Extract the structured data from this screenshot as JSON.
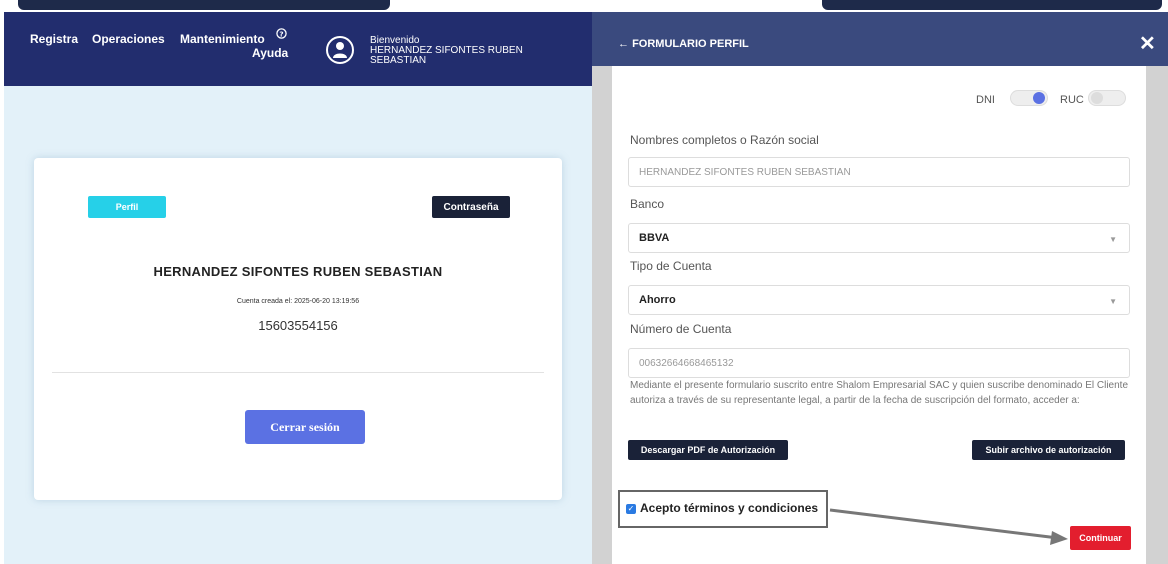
{
  "nav": {
    "items": [
      "Registra",
      "Operaciones",
      "Mantenimiento"
    ],
    "help_label": "Ayuda",
    "welcome_label": "Bienvenido",
    "user_name": "HERNANDEZ SIFONTES RUBEN SEBASTIAN"
  },
  "profile_card": {
    "perfil_button": "Perfil",
    "password_button": "Contraseña",
    "name": "HERNANDEZ SIFONTES RUBEN SEBASTIAN",
    "created_label": "Cuenta creada el: 2025-06-20 13:19:56",
    "phone": "15603554156",
    "logout_button": "Cerrar sesión"
  },
  "panel": {
    "title": "FORMULARIO PERFIL",
    "close_icon": "close-icon",
    "doc_type": {
      "dni_label": "DNI",
      "ruc_label": "RUC",
      "dni_on": true,
      "ruc_on": false
    },
    "fields": {
      "name_label": "Nombres completos o Razón social",
      "name_value": "HERNANDEZ SIFONTES RUBEN SEBASTIAN",
      "bank_label": "Banco",
      "bank_value": "BBVA",
      "account_type_label": "Tipo de Cuenta",
      "account_type_value": "Ahorro",
      "account_number_label": "Número de Cuenta",
      "account_number_value": "00632664668465132"
    },
    "legal_text": "Mediante el presente formulario suscrito entre Shalom Empresarial SAC y quien suscribe denominado El Cliente autoriza a través de su representante legal, a partir de la fecha de suscripción del formato, acceder a:",
    "download_button": "Descargar PDF de Autorización",
    "upload_button": "Subir archivo de autorización",
    "terms_label": "Acepto términos y condiciones",
    "terms_checked": true,
    "continue_button": "Continuar"
  },
  "colors": {
    "navbar": "#222d6e",
    "panel_header": "#3a4a7e",
    "accent_cyan": "#26d0e8",
    "accent_blue": "#5b71e3",
    "dark_button": "#1a2238",
    "continue_red": "#e31e2e"
  }
}
